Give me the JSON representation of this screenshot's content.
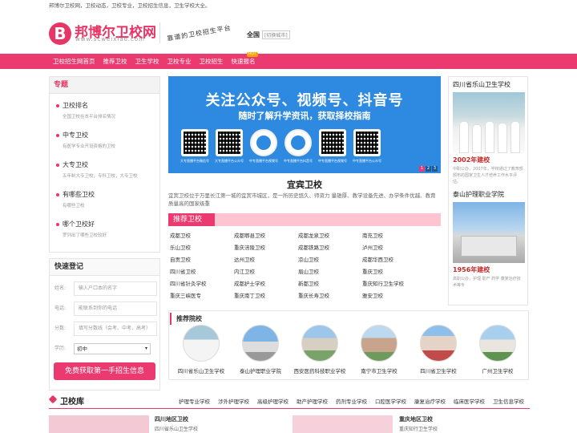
{
  "topbar": {
    "text": "邦博尔卫校网，卫校动态，卫校专业，卫校招生信息，卫生学校大全。"
  },
  "header": {
    "logo_letter": "B",
    "logo_text": "邦博尔卫校网",
    "logo_domain": "www.scweixiao.com",
    "slogan": "靠谱的卫校招生平台",
    "city": "全国",
    "city_switch": "[切换城市]"
  },
  "nav": {
    "items": [
      "卫校招生网首页",
      "推荐卫校",
      "卫生学校",
      "卫校专业",
      "卫校招生",
      "快速报名"
    ],
    "badge": "HOT"
  },
  "special": {
    "title": "专题",
    "items": [
      {
        "title": "卫校排名",
        "desc": "全国卫校在本平台排名情况"
      },
      {
        "title": "中专卫校",
        "desc": "有医学专业开设资格的卫校"
      },
      {
        "title": "大专卫校",
        "desc": "五年制大专卫校，专科卫校，大专卫校"
      },
      {
        "title": "有哪些卫校",
        "desc": "有哪些卫校"
      },
      {
        "title": "哪个卫校好",
        "desc": "罗列出了哪些卫校较好"
      }
    ]
  },
  "signup": {
    "title": "快速登记",
    "name_label": "姓名:",
    "name_placeholder": "输入户口本的名字",
    "phone_label": "电话:",
    "phone_placeholder": "能联系到你的电话",
    "score_label": "分数:",
    "score_placeholder": "填写分数线（会考、中考、高考）",
    "edu_label": "学历:",
    "edu_value": "初中",
    "submit": "免费获取第一手招生信息"
  },
  "banner": {
    "line1": "关注公众号、视频号、抖音号",
    "line2": "随时了解升学资讯，获取择校指南",
    "qr_captions": [
      "大专直播平台微信号",
      "大专直播平台公众号",
      "中专直播平台视频号",
      "中专直播平台抖音号",
      "中专直播平台视频号",
      "中专直播平台公众号"
    ],
    "dots": [
      "1",
      "2",
      "3"
    ]
  },
  "school": {
    "title": "宜宾卫校",
    "desc": "宜宾卫校位于万里长江第一城的宜宾市城区，是一所历史悠久、师资力 量雄厚、教学设备先进、办学条件优越、教育质量高的国家级重"
  },
  "recommend": {
    "title": "推荐卫校",
    "links": [
      "成都卫校",
      "成都郫县卫校",
      "成都龙泉卫校",
      "南充卫校",
      "乐山卫校",
      "重庆涪陵卫校",
      "成都铁路卫校",
      "泸州卫校",
      "自贡卫校",
      "达州卫校",
      "凉山卫校",
      "成都华西卫校",
      "四川省卫校",
      "内江卫校",
      "眉山卫校",
      "重庆卫校",
      "四川省针灸学校",
      "成都护士学校",
      "新都卫校",
      "重庆知行卫生学校",
      "重庆三峡医专",
      "重庆南丁卫校",
      "重庆长寿卫校",
      "雅安卫校"
    ]
  },
  "right": {
    "title1": "四川省乐山卫生学校",
    "year1": "2002年建校",
    "text1": "中职公办，2007年，学校通过了教育部颁布的国家卫生人才培养工作水平评估。",
    "title2": "泰山护理职业学院",
    "year2": "1956年建校",
    "text2": "高职公办，护理 助产 药学 康复治疗技术等专"
  },
  "schools": {
    "title": "推荐院校",
    "items": [
      "四川省乐山卫生学校",
      "泰山护理职业学院",
      "西安医药科技职业学校",
      "南宁市卫生学校",
      "四川省卫生学校",
      "广州卫生学校"
    ]
  },
  "library": {
    "title": "卫校库",
    "links": [
      "护理专业学校",
      "涉外护理学校",
      "高级护理学校",
      "助产护理学校",
      "药剂专业学校",
      "口腔医学学校",
      "康复治疗学校",
      "临床医学学校",
      "卫生信息学校"
    ]
  },
  "bottom": {
    "sichuan_title": "四川地区卫校",
    "sichuan_sub": "四川省乐山卫生学校",
    "chongqing_title": "重庆地区卫校",
    "chongqing_sub": "重庆知行卫生学校"
  },
  "colors": {
    "brand": "#e63566",
    "nav": "#ea3a6f",
    "banner": "#2e8ae0"
  }
}
